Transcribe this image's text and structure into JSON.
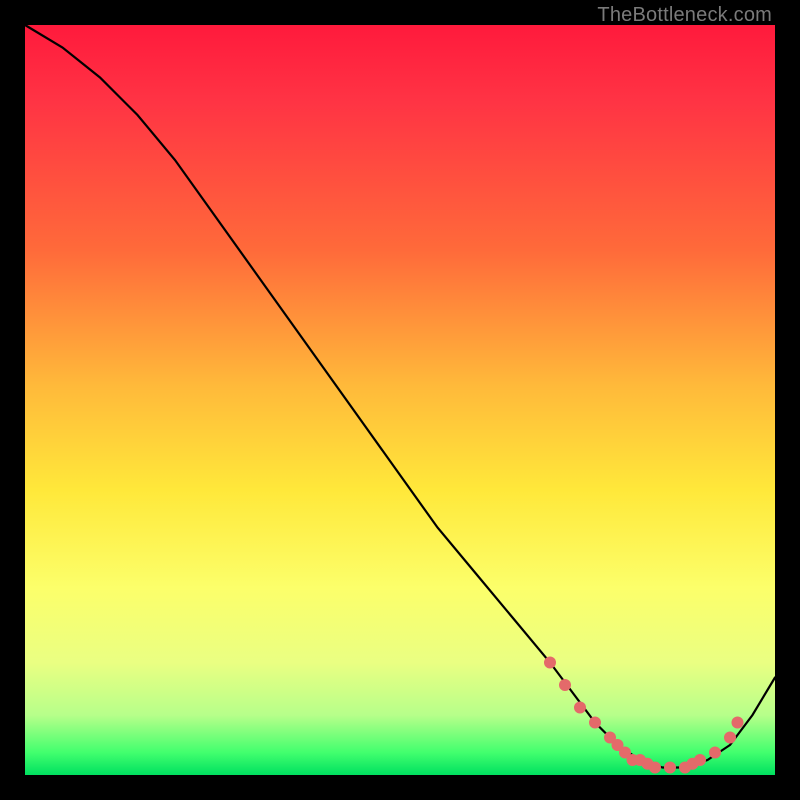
{
  "attribution": "TheBottleneck.com",
  "chart_data": {
    "type": "line",
    "title": "",
    "xlabel": "",
    "ylabel": "",
    "xlim": [
      0,
      100
    ],
    "ylim": [
      0,
      100
    ],
    "background_gradient": {
      "orientation": "vertical",
      "stops": [
        {
          "pos": 0,
          "color": "#ff1a3c",
          "meaning": "bad"
        },
        {
          "pos": 50,
          "color": "#ffd93a",
          "meaning": "mediocre"
        },
        {
          "pos": 100,
          "color": "#00e060",
          "meaning": "good"
        }
      ]
    },
    "series": [
      {
        "name": "bottleneck-curve",
        "x": [
          0,
          5,
          10,
          15,
          20,
          25,
          30,
          35,
          40,
          45,
          50,
          55,
          60,
          65,
          70,
          73,
          76,
          79,
          82,
          85,
          88,
          91,
          94,
          97,
          100
        ],
        "values": [
          100,
          97,
          93,
          88,
          82,
          75,
          68,
          61,
          54,
          47,
          40,
          33,
          27,
          21,
          15,
          11,
          7,
          4,
          2,
          1,
          1,
          2,
          4,
          8,
          13
        ]
      }
    ],
    "markers": [
      {
        "x": 70,
        "y": 15
      },
      {
        "x": 72,
        "y": 12
      },
      {
        "x": 74,
        "y": 9
      },
      {
        "x": 76,
        "y": 7
      },
      {
        "x": 78,
        "y": 5
      },
      {
        "x": 79,
        "y": 4
      },
      {
        "x": 80,
        "y": 3
      },
      {
        "x": 81,
        "y": 2
      },
      {
        "x": 82,
        "y": 2
      },
      {
        "x": 83,
        "y": 1.5
      },
      {
        "x": 84,
        "y": 1
      },
      {
        "x": 86,
        "y": 1
      },
      {
        "x": 88,
        "y": 1
      },
      {
        "x": 89,
        "y": 1.5
      },
      {
        "x": 90,
        "y": 2
      },
      {
        "x": 92,
        "y": 3
      },
      {
        "x": 94,
        "y": 5
      },
      {
        "x": 95,
        "y": 7
      }
    ],
    "marker_style": {
      "color": "#e46a6a",
      "radius": 6
    }
  }
}
